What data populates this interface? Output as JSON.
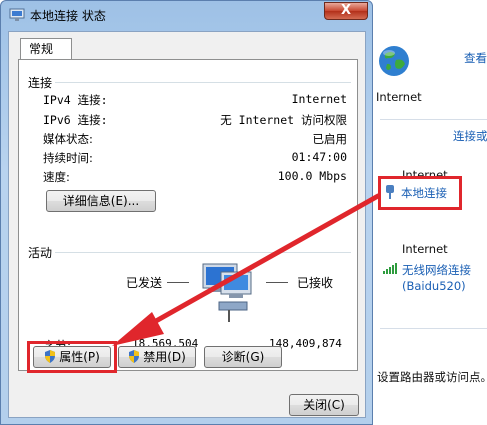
{
  "window": {
    "title": "本地连接 状态",
    "close_symbol": "X"
  },
  "tabs": [
    {
      "label": "常规"
    }
  ],
  "connection": {
    "heading": "连接",
    "rows": [
      {
        "label": "IPv4 连接:",
        "value": "Internet"
      },
      {
        "label": "IPv6 连接:",
        "value": "无 Internet 访问权限"
      },
      {
        "label": "媒体状态:",
        "value": "已启用"
      },
      {
        "label": "持续时间:",
        "value": "01:47:00"
      },
      {
        "label": "速度:",
        "value": "100.0 Mbps"
      }
    ],
    "details_button": "详细信息(E)..."
  },
  "activity": {
    "heading": "活动",
    "sent_label": "已发送",
    "received_label": "已接收",
    "bytes_label": "字节:",
    "sent_value": "18,569,504",
    "received_value": "148,409,874"
  },
  "buttons": {
    "properties": "属性(P)",
    "disable": "禁用(D)",
    "diagnose": "诊断(G)",
    "close": "关闭(C)"
  },
  "background": {
    "view_link": "查看",
    "internet_label_1": "Internet",
    "connect_or_link": "连接或",
    "internet_label_2": "Internet",
    "local_connection_link": "本地连接",
    "internet_label_3": "Internet",
    "wireless_link": "无线网络连接",
    "wireless_ssid": "(Baidu520)",
    "bottom_text": "设置路由器或访问点。"
  },
  "colors": {
    "annotation_red": "#e0262c",
    "link_blue": "#1a5fb4"
  }
}
